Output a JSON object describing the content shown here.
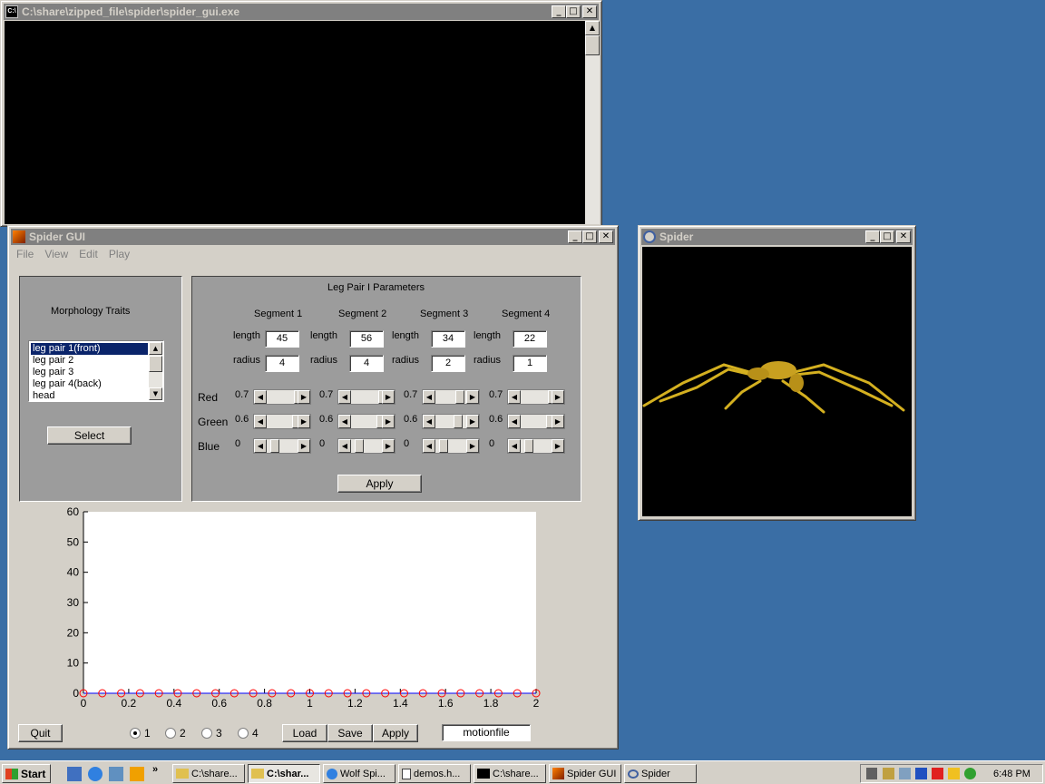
{
  "console": {
    "title": "C:\\share\\zipped_file\\spider\\spider_gui.exe"
  },
  "gui": {
    "title": "Spider  GUI",
    "menu": [
      "File",
      "View",
      "Edit",
      "Play"
    ],
    "morph": {
      "title": "Morphology Traits",
      "items": [
        "leg pair 1(front)",
        "leg pair 2",
        "leg pair 3",
        "leg pair 4(back)",
        "head"
      ],
      "select_label": "Select"
    },
    "params": {
      "title": "Leg Pair I Parameters",
      "segments": [
        "Segment 1",
        "Segment 2",
        "Segment 3",
        "Segment 4"
      ],
      "length_label": "length",
      "radius_label": "radius",
      "lengths": [
        "45",
        "56",
        "34",
        "22"
      ],
      "radii": [
        "4",
        "4",
        "2",
        "1"
      ],
      "color_labels": [
        "Red",
        "Green",
        "Blue"
      ],
      "red_vals": [
        "0.7",
        "0.7",
        "0.7",
        "0.7"
      ],
      "green_vals": [
        "0.6",
        "0.6",
        "0.6",
        "0.6"
      ],
      "blue_vals": [
        "0",
        "0",
        "0",
        "0"
      ],
      "apply_label": "Apply"
    },
    "bottom": {
      "quit_label": "Quit",
      "radios": [
        "1",
        "2",
        "3",
        "4"
      ],
      "load_label": "Load",
      "save_label": "Save",
      "apply_label": "Apply",
      "file_value": "motionfile"
    }
  },
  "spider_window": {
    "title": "Spider"
  },
  "taskbar": {
    "start": "Start",
    "items": [
      "C:\\share...",
      "C:\\shar...",
      "Wolf Spi...",
      "demos.h...",
      "C:\\share...",
      "Spider  GUI",
      "Spider"
    ],
    "clock": "6:48 PM"
  },
  "chart_data": {
    "type": "scatter",
    "x": [
      0,
      0.0833,
      0.1667,
      0.25,
      0.3333,
      0.4167,
      0.5,
      0.5833,
      0.6667,
      0.75,
      0.8333,
      0.9167,
      1.0,
      1.0833,
      1.1667,
      1.25,
      1.3333,
      1.4167,
      1.5,
      1.5833,
      1.6667,
      1.75,
      1.8333,
      1.9167,
      2.0
    ],
    "y": [
      0,
      0,
      0,
      0,
      0,
      0,
      0,
      0,
      0,
      0,
      0,
      0,
      0,
      0,
      0,
      0,
      0,
      0,
      0,
      0,
      0,
      0,
      0,
      0,
      0
    ],
    "xlim": [
      0,
      2
    ],
    "ylim": [
      0,
      60
    ],
    "xticks": [
      "0",
      "0.2",
      "0.4",
      "0.6",
      "0.8",
      "1",
      "1.2",
      "1.4",
      "1.6",
      "1.8",
      "2"
    ],
    "yticks": [
      "0",
      "10",
      "20",
      "30",
      "40",
      "50",
      "60"
    ],
    "marker_color": "#ff0000",
    "line_color": "#0000ff"
  }
}
